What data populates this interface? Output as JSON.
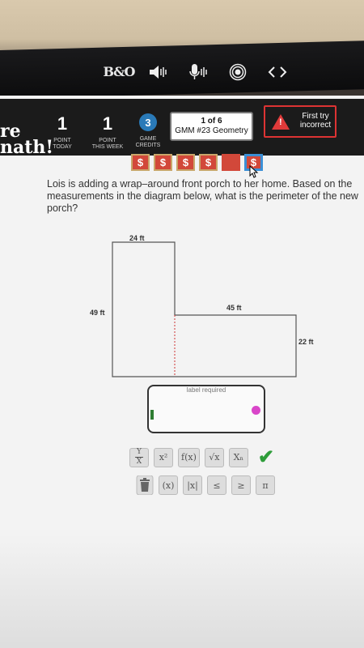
{
  "touchbar": {
    "logo": "B&O",
    "icons": [
      "speaker-volume-icon",
      "microphone-icon",
      "broadcast-icon",
      "code-brackets-icon"
    ]
  },
  "header": {
    "brand_line1": "re",
    "brand_line2": "nath!",
    "stats": [
      {
        "value": "1",
        "label_line1": "POINT",
        "label_line2": "TODAY"
      },
      {
        "value": "1",
        "label_line1": "POINT",
        "label_line2": "THIS WEEK"
      },
      {
        "value": "3",
        "label_line1": "GAME",
        "label_line2": "CREDITS"
      }
    ],
    "progress": "1 of 6",
    "assignment": "GMM #23 Geometry",
    "status": "First try incorrect",
    "status_icon": "warning-icon",
    "accent_colors": {
      "bar": "#1b1b1b",
      "warning": "#d33",
      "credit_blue": "#2a7ab8"
    }
  },
  "credits": [
    "$",
    "$",
    "$",
    "$",
    "",
    "$"
  ],
  "question": {
    "text": "Lois is adding a wrap–around front porch to her home. Based on the measurements in the diagram below, what is the perimeter of the new porch?"
  },
  "diagram": {
    "top_label": "24 ft",
    "left_label": "49 ft",
    "inner_top_label": "45 ft",
    "right_label": "22 ft"
  },
  "answer": {
    "hint": "label required",
    "value": ""
  },
  "toolbar": {
    "row1": [
      "Y/X",
      "x²",
      "f(x)",
      "√x",
      "Xₙ"
    ],
    "row2": [
      "(x)",
      "|x|",
      "≤",
      "≥",
      "π"
    ]
  }
}
